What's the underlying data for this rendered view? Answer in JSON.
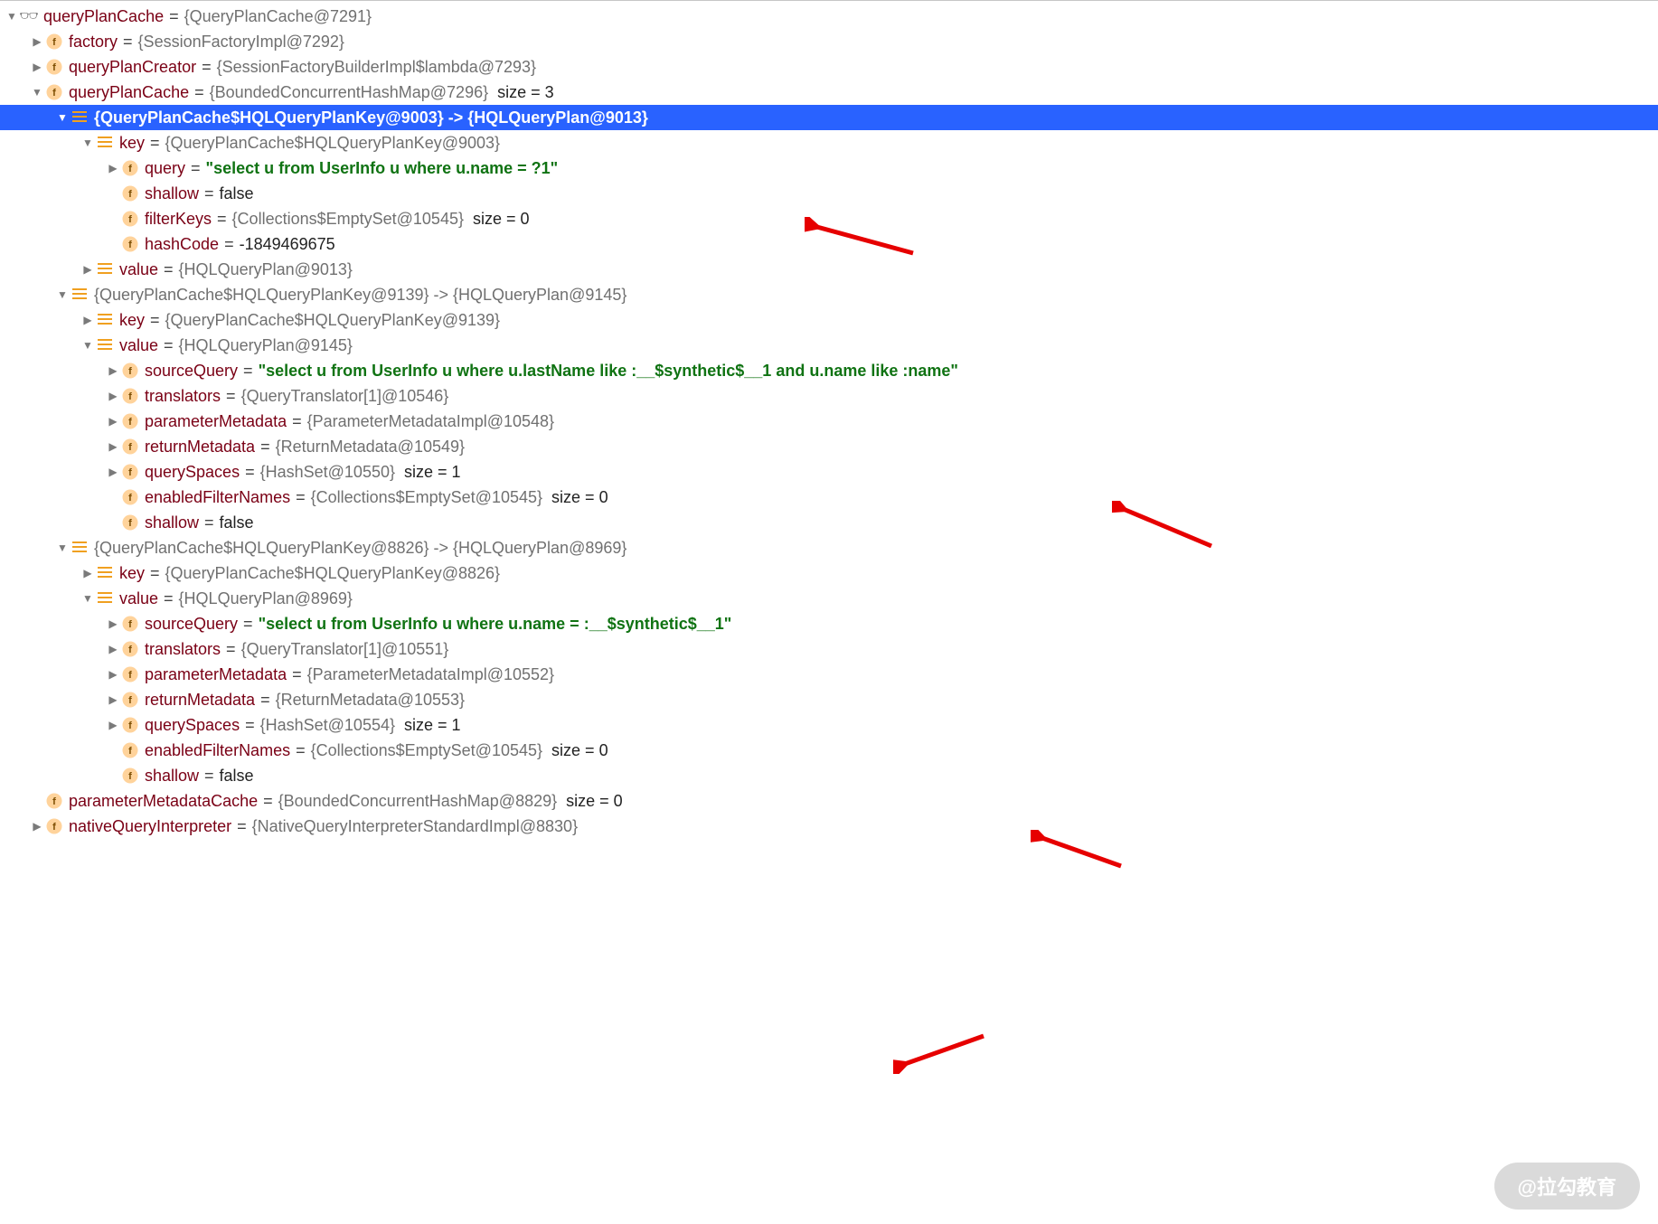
{
  "root": {
    "name": "queryPlanCache",
    "value": "{QueryPlanCache@7291}"
  },
  "factory": {
    "name": "factory",
    "value": "{SessionFactoryImpl@7292}"
  },
  "queryPlanCreator": {
    "name": "queryPlanCreator",
    "value": "{SessionFactoryBuilderImpl$lambda@7293}"
  },
  "queryPlanCacheMap": {
    "name": "queryPlanCache",
    "value": "{BoundedConcurrentHashMap@7296}",
    "size": "size = 3"
  },
  "entry1": {
    "header": "{QueryPlanCache$HQLQueryPlanKey@9003}  -> {HQLQueryPlan@9013}",
    "key": {
      "name": "key",
      "value": "{QueryPlanCache$HQLQueryPlanKey@9003}"
    },
    "query": {
      "name": "query",
      "value": "\"select u from UserInfo u where u.name = ?1\""
    },
    "shallow": {
      "name": "shallow",
      "value": "false"
    },
    "filterKeys": {
      "name": "filterKeys",
      "value": "{Collections$EmptySet@10545}",
      "size": "size = 0"
    },
    "hashCode": {
      "name": "hashCode",
      "value": "-1849469675"
    },
    "valueNode": {
      "name": "value",
      "value": "{HQLQueryPlan@9013}"
    }
  },
  "entry2": {
    "header": "{QueryPlanCache$HQLQueryPlanKey@9139}  -> {HQLQueryPlan@9145}",
    "key": {
      "name": "key",
      "value": "{QueryPlanCache$HQLQueryPlanKey@9139}"
    },
    "valueNode": {
      "name": "value",
      "value": "{HQLQueryPlan@9145}"
    },
    "sourceQuery": {
      "name": "sourceQuery",
      "value": "\"select u from UserInfo u where u.lastName like :__$synthetic$__1 and u.name like :name\""
    },
    "translators": {
      "name": "translators",
      "value": "{QueryTranslator[1]@10546}"
    },
    "parameterMetadata": {
      "name": "parameterMetadata",
      "value": "{ParameterMetadataImpl@10548}"
    },
    "returnMetadata": {
      "name": "returnMetadata",
      "value": "{ReturnMetadata@10549}"
    },
    "querySpaces": {
      "name": "querySpaces",
      "value": "{HashSet@10550}",
      "size": "size = 1"
    },
    "enabledFilterNames": {
      "name": "enabledFilterNames",
      "value": "{Collections$EmptySet@10545}",
      "size": "size = 0"
    },
    "shallow": {
      "name": "shallow",
      "value": "false"
    }
  },
  "entry3": {
    "header": "{QueryPlanCache$HQLQueryPlanKey@8826}  -> {HQLQueryPlan@8969}",
    "key": {
      "name": "key",
      "value": "{QueryPlanCache$HQLQueryPlanKey@8826}"
    },
    "valueNode": {
      "name": "value",
      "value": "{HQLQueryPlan@8969}"
    },
    "sourceQuery": {
      "name": "sourceQuery",
      "value": "\"select u from UserInfo u where u.name = :__$synthetic$__1\""
    },
    "translators": {
      "name": "translators",
      "value": "{QueryTranslator[1]@10551}"
    },
    "parameterMetadata": {
      "name": "parameterMetadata",
      "value": "{ParameterMetadataImpl@10552}"
    },
    "returnMetadata": {
      "name": "returnMetadata",
      "value": "{ReturnMetadata@10553}"
    },
    "querySpaces": {
      "name": "querySpaces",
      "value": "{HashSet@10554}",
      "size": "size = 1"
    },
    "enabledFilterNames": {
      "name": "enabledFilterNames",
      "value": "{Collections$EmptySet@10545}",
      "size": "size = 0"
    },
    "shallow": {
      "name": "shallow",
      "value": "false"
    }
  },
  "parameterMetadataCache": {
    "name": "parameterMetadataCache",
    "value": "{BoundedConcurrentHashMap@8829}",
    "size": "size = 0"
  },
  "nativeQueryInterpreter": {
    "name": "nativeQueryInterpreter",
    "value": "{NativeQueryInterpreterStandardImpl@8830}"
  },
  "watermark": "@拉勾教育"
}
